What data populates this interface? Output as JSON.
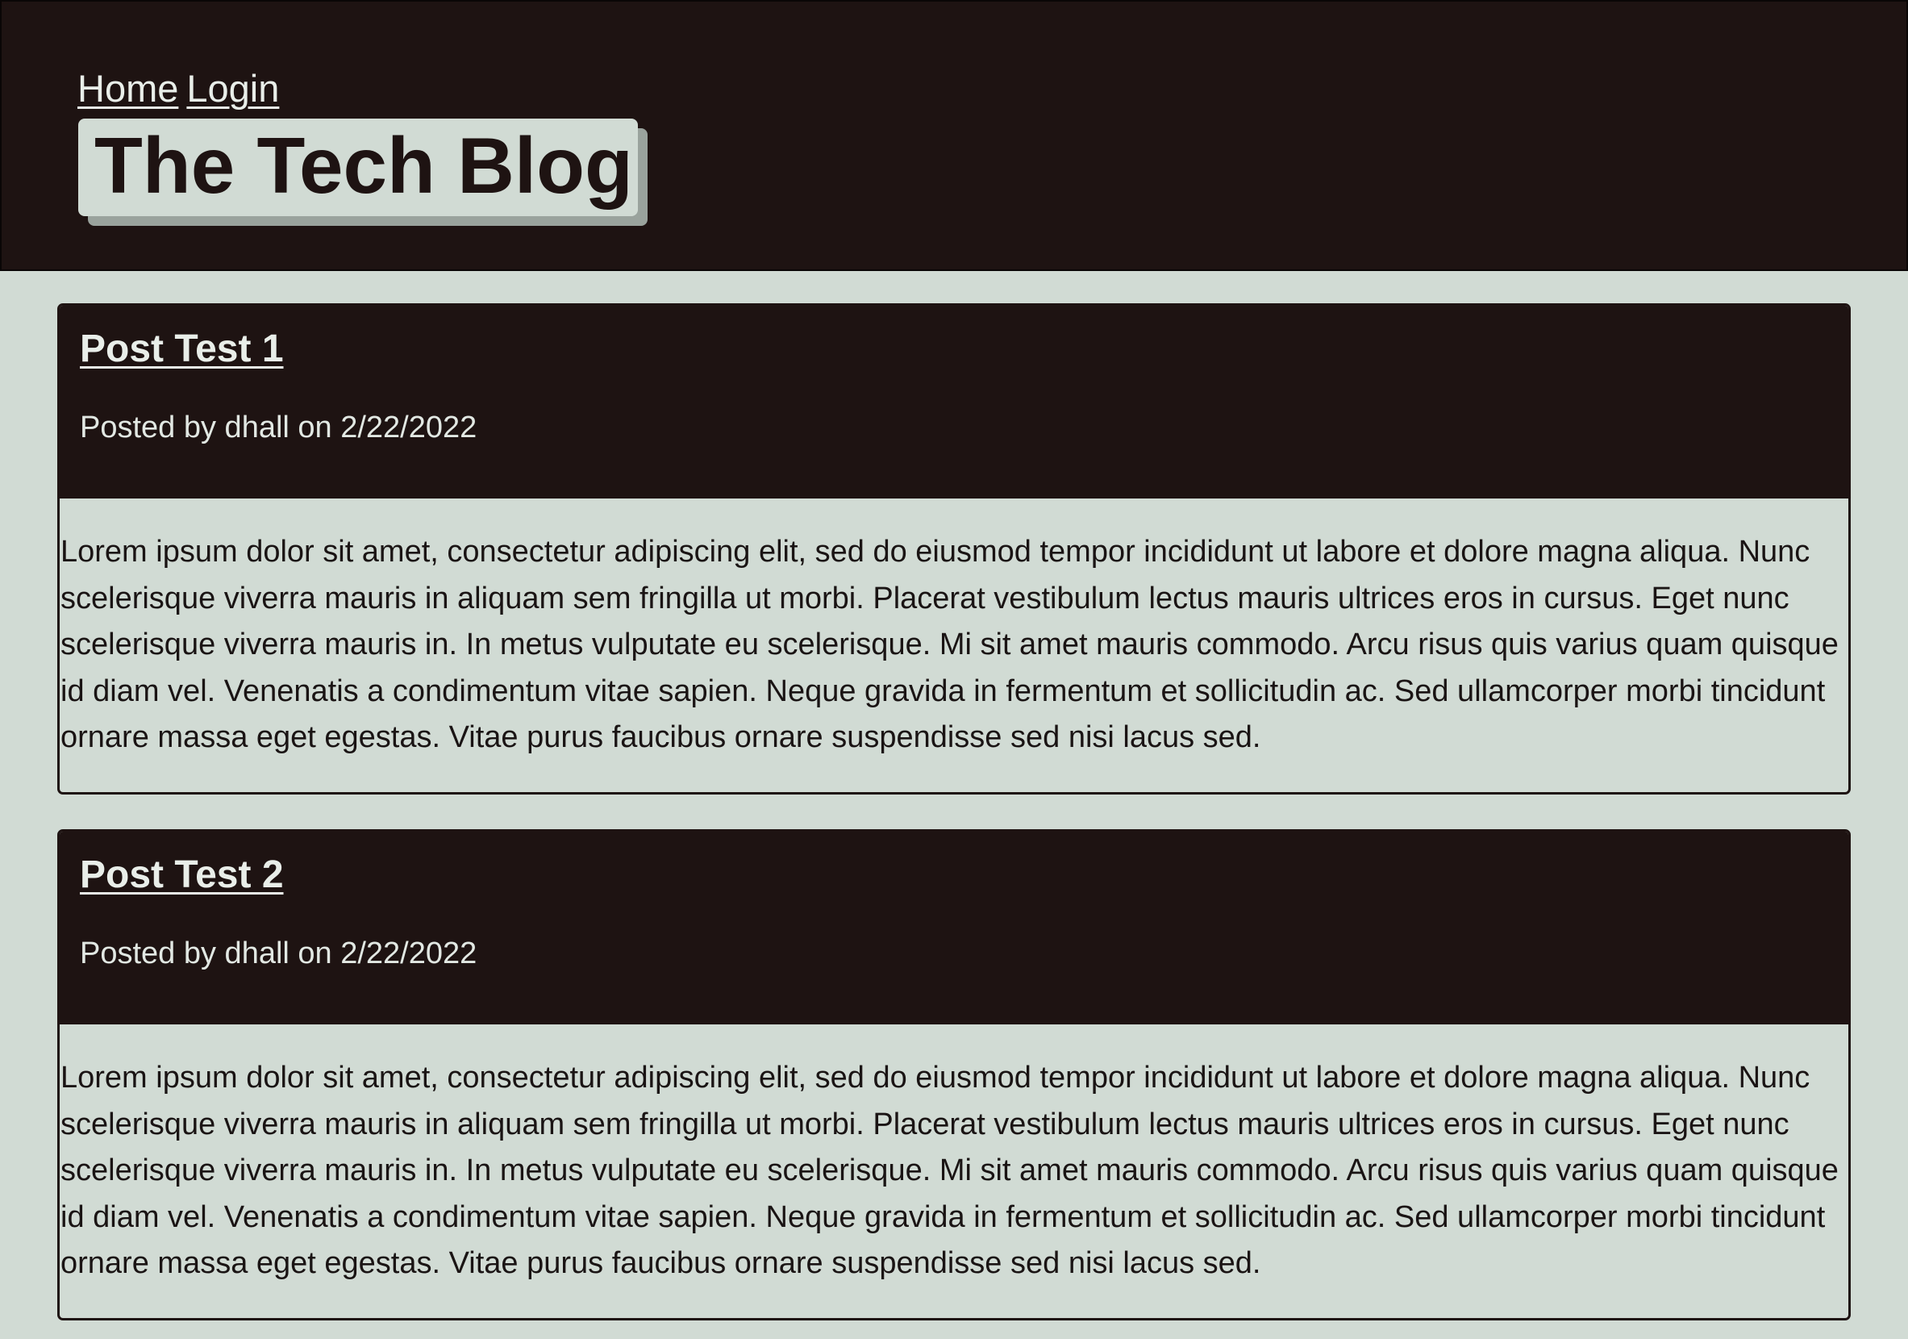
{
  "nav": {
    "home": "Home",
    "login": "Login"
  },
  "site": {
    "title": "The Tech Blog"
  },
  "posts": [
    {
      "title": "Post Test 1",
      "meta": "Posted by dhall on 2/22/2022",
      "body": "Lorem ipsum dolor sit amet, consectetur adipiscing elit, sed do eiusmod tempor incididunt ut labore et dolore magna aliqua. Nunc scelerisque viverra mauris in aliquam sem fringilla ut morbi. Placerat vestibulum lectus mauris ultrices eros in cursus. Eget nunc scelerisque viverra mauris in. In metus vulputate eu scelerisque. Mi sit amet mauris commodo. Arcu risus quis varius quam quisque id diam vel. Venenatis a condimentum vitae sapien. Neque gravida in fermentum et sollicitudin ac. Sed ullamcorper morbi tincidunt ornare massa eget egestas. Vitae purus faucibus ornare suspendisse sed nisi lacus sed."
    },
    {
      "title": "Post Test 2",
      "meta": "Posted by dhall on 2/22/2022",
      "body": "Lorem ipsum dolor sit amet, consectetur adipiscing elit, sed do eiusmod tempor incididunt ut labore et dolore magna aliqua. Nunc scelerisque viverra mauris in aliquam sem fringilla ut morbi. Placerat vestibulum lectus mauris ultrices eros in cursus. Eget nunc scelerisque viverra mauris in. In metus vulputate eu scelerisque. Mi sit amet mauris commodo. Arcu risus quis varius quam quisque id diam vel. Venenatis a condimentum vitae sapien. Neque gravida in fermentum et sollicitudin ac. Sed ullamcorper morbi tincidunt ornare massa eget egestas. Vitae purus faucibus ornare suspendisse sed nisi lacus sed."
    }
  ],
  "colors": {
    "header_bg": "#1e1312",
    "page_bg": "#d1dbd4",
    "light_text": "#e9eee9",
    "title_shadow": "#9aa39d"
  }
}
